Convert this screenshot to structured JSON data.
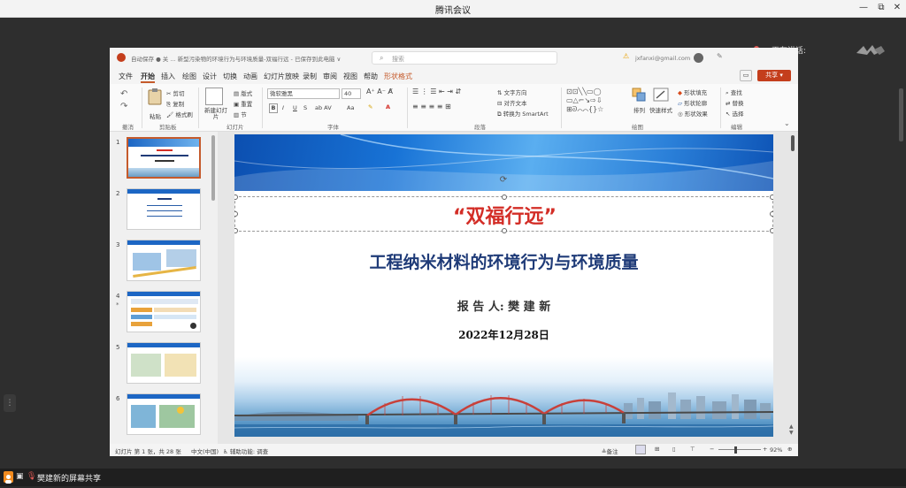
{
  "meeting": {
    "title": "腾讯会议",
    "speaking_label": "正在讲话:",
    "share_label": "樊建新的屏幕共享"
  },
  "ppt": {
    "title_text": "自动保存  ● 关   ...   新型污染物的环境行为与环境质量-双福行远 - 已保存到此电脑 ∨",
    "search_placeholder": "搜索",
    "account": "jxfanxi@gmail.com",
    "share_button": "共享",
    "menu": [
      "文件",
      "开始",
      "插入",
      "绘图",
      "设计",
      "切换",
      "动画",
      "幻灯片放映",
      "录制",
      "审阅",
      "视图",
      "帮助",
      "形状格式"
    ],
    "active_menu": "开始",
    "ribbon": {
      "undo_group": "撤消",
      "clipboard": {
        "paste": "粘贴",
        "cut": "剪切",
        "copy": "复制",
        "format_painter": "格式刷",
        "label": "剪贴板"
      },
      "slides": {
        "new_slide": "新建幻灯片",
        "layout": "版式",
        "reset": "重置",
        "section": "节",
        "label": "幻灯片"
      },
      "font": {
        "name": "微软雅黑",
        "size": "40",
        "label": "字体",
        "bold": "B",
        "italic": "I",
        "underline": "U",
        "strike": "S",
        "case": "Aa"
      },
      "paragraph": {
        "text_direction": "文字方向",
        "align_text": "对齐文本",
        "smartart": "转换为 SmartArt",
        "label": "段落"
      },
      "drawing": {
        "arrange": "排列",
        "quick_styles": "快速样式",
        "fill": "形状填充",
        "outline": "形状轮廓",
        "effects": "形状效果",
        "label": "绘图"
      },
      "editing": {
        "find": "查找",
        "replace": "替换",
        "select": "选择",
        "label": "编辑"
      }
    },
    "status": {
      "slide_info": "幻灯片 第 1 张，共 28 张",
      "language": "中文(中国)",
      "accessibility": "辅助功能: 调查",
      "notes": "备注",
      "zoom": "92%"
    },
    "thumbnails": [
      "1",
      "2",
      "3",
      "4",
      "5",
      "6"
    ],
    "slide": {
      "slogan": "“双福行远”",
      "main_title": "工程纳米材料的环境行为与环境质量",
      "reporter": "报 告 人: 樊 建 新",
      "date": "2022年12月28日"
    }
  },
  "colors": {
    "accent_red": "#d32d26",
    "title_blue": "#1f3b78",
    "ppt_orange": "#c55a2b"
  }
}
